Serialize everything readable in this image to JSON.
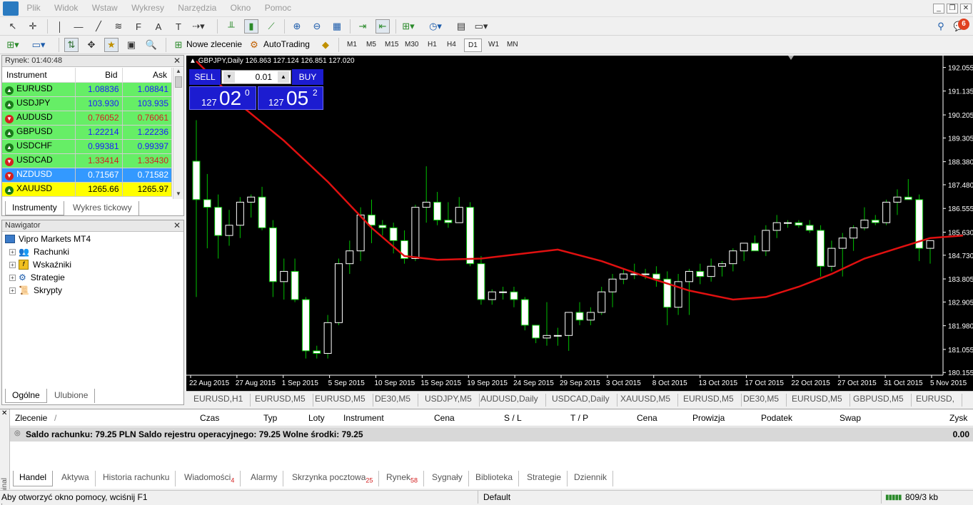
{
  "menu": [
    "Plik",
    "Widok",
    "Wstaw",
    "Wykresy",
    "Narzędzia",
    "Okno",
    "Pomoc"
  ],
  "toolbar": {
    "new_order": "Nowe zlecenie",
    "autotrading": "AutoTrading",
    "timeframes": [
      "M1",
      "M5",
      "M15",
      "M30",
      "H1",
      "H4",
      "D1",
      "W1",
      "MN"
    ],
    "active_tf": "D1",
    "notif_count": "6"
  },
  "market": {
    "title": "Rynek: 01:40:48",
    "col_instrument": "Instrument",
    "col_bid": "Bid",
    "col_ask": "Ask",
    "rows": [
      {
        "symbol": "EURUSD",
        "bid": "1.08836",
        "ask": "1.08841",
        "bg": "#66ee66",
        "color": "#1a1aff",
        "dir": "up"
      },
      {
        "symbol": "USDJPY",
        "bid": "103.930",
        "ask": "103.935",
        "bg": "#66ee66",
        "color": "#1a1aff",
        "dir": "up"
      },
      {
        "symbol": "AUDUSD",
        "bid": "0.76052",
        "ask": "0.76061",
        "bg": "#66ee66",
        "color": "#d42020",
        "dir": "down"
      },
      {
        "symbol": "GBPUSD",
        "bid": "1.22214",
        "ask": "1.22236",
        "bg": "#66ee66",
        "color": "#1a1aff",
        "dir": "up"
      },
      {
        "symbol": "USDCHF",
        "bid": "0.99381",
        "ask": "0.99397",
        "bg": "#66ee66",
        "color": "#1a1aff",
        "dir": "up"
      },
      {
        "symbol": "USDCAD",
        "bid": "1.33414",
        "ask": "1.33430",
        "bg": "#66ee66",
        "color": "#d42020",
        "dir": "down"
      },
      {
        "symbol": "NZDUSD",
        "bid": "0.71567",
        "ask": "0.71582",
        "bg": "#3399ff",
        "color": "#ffffff",
        "dir": "down"
      },
      {
        "symbol": "XAUUSD",
        "bid": "1265.66",
        "ask": "1265.97",
        "bg": "#ffff00",
        "color": "#000000",
        "dir": "up"
      }
    ],
    "tab_instruments": "Instrumenty",
    "tab_tick": "Wykres tickowy"
  },
  "navigator": {
    "title": "Nawigator",
    "root": "Vipro Markets MT4",
    "items": [
      "Rachunki",
      "Wskaźniki",
      "Strategie",
      "Skrypty"
    ],
    "tab_general": "Ogólne",
    "tab_fav": "Ulubione"
  },
  "chart": {
    "header": "GBPJPY,Daily  126.863 127.124 126.851 127.020",
    "sell": "SELL",
    "buy": "BUY",
    "lot": "0.01",
    "sell_big": "02",
    "sell_small": "127",
    "sell_sup": "0",
    "buy_big": "05",
    "buy_small": "127",
    "buy_sup": "2",
    "price_labels": [
      "192.055",
      "191.135",
      "190.205",
      "189.305",
      "188.380",
      "187.480",
      "186.555",
      "185.630",
      "184.730",
      "183.805",
      "182.905",
      "181.980",
      "181.055",
      "180.155"
    ],
    "date_labels": [
      "22 Aug 2015",
      "27 Aug 2015",
      "1 Sep 2015",
      "5 Sep 2015",
      "10 Sep 2015",
      "15 Sep 2015",
      "19 Sep 2015",
      "24 Sep 2015",
      "29 Sep 2015",
      "3 Oct 2015",
      "8 Oct 2015",
      "13 Oct 2015",
      "17 Oct 2015",
      "22 Oct 2015",
      "27 Oct 2015",
      "31 Oct 2015",
      "5 Nov 2015"
    ]
  },
  "chart_tabs": [
    "EURUSD,H1",
    "EURUSD,M5",
    "EURUSD,M5",
    "DE30,M5",
    "USDJPY,M5",
    "AUDUSD,Daily",
    "USDCAD,Daily",
    "XAUUSD,M5",
    "EURUSD,M5",
    "DE30,M5",
    "EURUSD,M5",
    "GBPUSD,M5",
    "EURUSD,"
  ],
  "terminal": {
    "side_label": "Terminal",
    "cols": [
      "Zlecenie",
      "/",
      "Czas",
      "Typ",
      "Loty",
      "Instrument",
      "Cena",
      "S / L",
      "T / P",
      "Cena",
      "Prowizja",
      "Podatek",
      "Swap",
      "Zysk"
    ],
    "balance": "Saldo rachunku: 79.25 PLN  Saldo rejestru operacyjnego: 79.25  Wolne środki: 79.25",
    "profit": "0.00",
    "tabs": [
      {
        "label": "Handel",
        "badge": ""
      },
      {
        "label": "Aktywa",
        "badge": ""
      },
      {
        "label": "Historia rachunku",
        "badge": ""
      },
      {
        "label": "Wiadomości",
        "badge": "4"
      },
      {
        "label": "Alarmy",
        "badge": ""
      },
      {
        "label": "Skrzynka pocztowa",
        "badge": "25"
      },
      {
        "label": "Rynek",
        "badge": "58"
      },
      {
        "label": "Sygnały",
        "badge": ""
      },
      {
        "label": "Biblioteka",
        "badge": ""
      },
      {
        "label": "Strategie",
        "badge": ""
      },
      {
        "label": "Dziennik",
        "badge": ""
      }
    ]
  },
  "status": {
    "help": "Aby otworzyć okno pomocy, wciśnij F1",
    "profile": "Default",
    "traffic": "809/3 kb"
  },
  "colors": {
    "bull": "#ffffff",
    "bear": "#ffffff",
    "wick": "#00c000",
    "ma": "#e01010"
  },
  "candles": [
    [
      188.4,
      190.0,
      183.1,
      186.9
    ],
    [
      186.9,
      187.9,
      185.0,
      186.6
    ],
    [
      186.6,
      187.1,
      184.6,
      185.5
    ],
    [
      185.5,
      186.5,
      185.1,
      185.9
    ],
    [
      185.9,
      187.0,
      185.4,
      186.8
    ],
    [
      186.8,
      187.1,
      186.2,
      187.0
    ],
    [
      187.0,
      187.4,
      185.7,
      185.8
    ],
    [
      185.8,
      186.1,
      183.1,
      183.7
    ],
    [
      183.7,
      184.6,
      183.0,
      184.1
    ],
    [
      184.1,
      184.6,
      182.9,
      183.0
    ],
    [
      183.0,
      183.1,
      180.7,
      181.0
    ],
    [
      181.0,
      181.2,
      180.7,
      180.9
    ],
    [
      180.9,
      182.4,
      180.7,
      182.1
    ],
    [
      182.1,
      184.6,
      182.0,
      184.4
    ],
    [
      184.4,
      185.3,
      184.0,
      184.9
    ],
    [
      184.9,
      186.6,
      184.5,
      186.3
    ],
    [
      186.3,
      186.9,
      185.2,
      185.9
    ],
    [
      185.9,
      186.1,
      185.5,
      185.8
    ],
    [
      185.8,
      186.0,
      184.8,
      185.3
    ],
    [
      185.3,
      185.7,
      184.4,
      184.6
    ],
    [
      184.6,
      186.7,
      184.5,
      186.6
    ],
    [
      186.6,
      188.2,
      186.0,
      186.8
    ],
    [
      186.8,
      187.2,
      185.9,
      186.1
    ],
    [
      186.1,
      186.8,
      185.8,
      186.0
    ],
    [
      186.0,
      187.0,
      186.0,
      186.6
    ],
    [
      186.6,
      186.8,
      184.3,
      184.4
    ],
    [
      184.4,
      184.7,
      182.8,
      183.0
    ],
    [
      183.0,
      183.4,
      182.8,
      183.3
    ],
    [
      183.3,
      183.5,
      183.0,
      183.3
    ],
    [
      183.3,
      183.5,
      182.7,
      183.0
    ],
    [
      183.0,
      183.1,
      181.8,
      182.0
    ],
    [
      182.0,
      182.0,
      181.3,
      181.5
    ],
    [
      181.5,
      182.9,
      181.2,
      181.6
    ],
    [
      181.6,
      181.9,
      181.2,
      181.6
    ],
    [
      181.6,
      182.5,
      181.0,
      182.5
    ],
    [
      182.5,
      182.9,
      182.0,
      182.2
    ],
    [
      182.2,
      182.7,
      182.0,
      182.5
    ],
    [
      182.5,
      183.5,
      182.4,
      183.3
    ],
    [
      183.3,
      184.0,
      182.7,
      183.8
    ],
    [
      183.8,
      184.2,
      183.6,
      184.0
    ],
    [
      184.0,
      184.4,
      183.8,
      184.0
    ],
    [
      184.0,
      184.2,
      183.8,
      184.0
    ],
    [
      184.0,
      184.3,
      183.5,
      183.8
    ],
    [
      183.8,
      184.1,
      182.0,
      182.7
    ],
    [
      182.7,
      184.0,
      182.4,
      183.7
    ],
    [
      183.7,
      184.2,
      182.4,
      184.1
    ],
    [
      184.1,
      184.4,
      183.6,
      183.9
    ],
    [
      183.9,
      184.6,
      183.7,
      184.3
    ],
    [
      184.3,
      184.5,
      183.9,
      184.4
    ],
    [
      184.4,
      185.0,
      184.1,
      184.9
    ],
    [
      184.9,
      185.2,
      184.5,
      185.2
    ],
    [
      185.2,
      185.5,
      184.9,
      184.9
    ],
    [
      184.9,
      185.9,
      184.7,
      185.7
    ],
    [
      185.7,
      186.3,
      185.4,
      186.0
    ],
    [
      186.0,
      186.1,
      185.8,
      186.0
    ],
    [
      186.0,
      186.1,
      185.8,
      185.9
    ],
    [
      185.9,
      186.1,
      185.6,
      185.7
    ],
    [
      185.7,
      185.9,
      183.9,
      184.3
    ],
    [
      184.3,
      185.3,
      184.1,
      185.0
    ],
    [
      185.0,
      185.6,
      183.9,
      185.4
    ],
    [
      185.4,
      185.9,
      184.9,
      185.8
    ],
    [
      185.8,
      186.6,
      185.7,
      186.1
    ],
    [
      186.1,
      186.3,
      185.9,
      186.0
    ],
    [
      186.0,
      186.9,
      185.9,
      186.8
    ],
    [
      186.8,
      187.3,
      186.3,
      187.0
    ],
    [
      187.0,
      187.7,
      186.9,
      186.9
    ],
    [
      186.9,
      187.1,
      184.5,
      185.0
    ],
    [
      185.0,
      185.3,
      184.4,
      185.3
    ]
  ],
  "ma": [
    [
      0,
      192.3
    ],
    [
      4,
      190.6
    ],
    [
      8,
      189.2
    ],
    [
      12,
      187.6
    ],
    [
      16,
      185.8
    ],
    [
      19,
      184.7
    ],
    [
      22,
      184.55
    ],
    [
      26,
      184.6
    ],
    [
      30,
      184.8
    ],
    [
      33,
      184.95
    ],
    [
      37,
      184.5
    ],
    [
      41,
      183.9
    ],
    [
      45,
      183.35
    ],
    [
      49,
      183.0
    ],
    [
      52,
      183.1
    ],
    [
      55,
      183.5
    ],
    [
      58,
      184.0
    ],
    [
      61,
      184.6
    ],
    [
      64,
      185.0
    ],
    [
      67,
      185.4
    ],
    [
      70,
      185.5
    ]
  ]
}
